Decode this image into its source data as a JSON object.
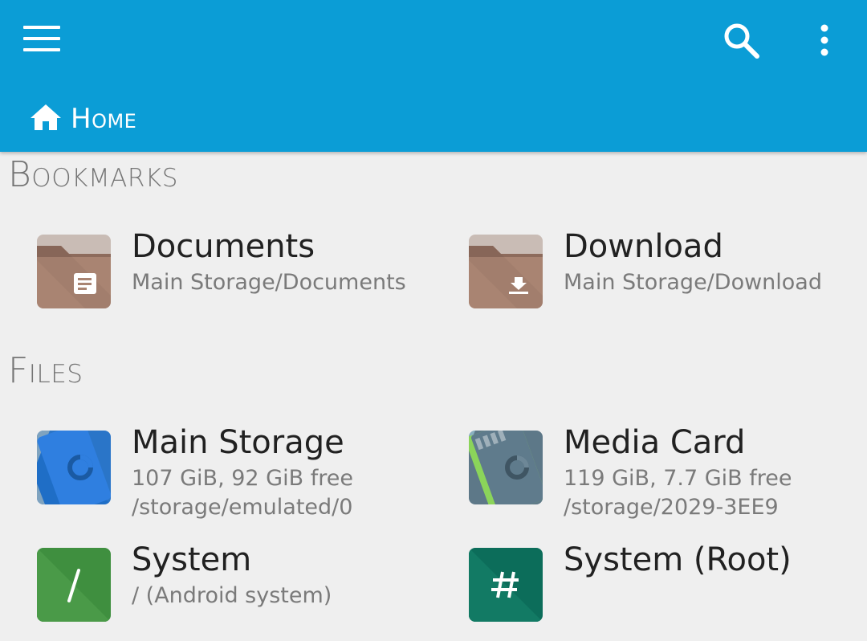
{
  "header": {
    "menu_icon": "hamburger-menu-icon",
    "search_icon": "search-icon",
    "more_icon": "more-vertical-icon",
    "breadcrumb": {
      "icon": "home-icon",
      "label": "Home"
    },
    "colors": {
      "appbar": "#0b9dd6",
      "background": "#efefef"
    }
  },
  "bookmarks": {
    "title": "Bookmarks",
    "items": [
      {
        "name": "Documents",
        "path": "Main Storage/Documents",
        "icon": "documents-folder-icon"
      },
      {
        "name": "Download",
        "path": "Main Storage/Download",
        "icon": "download-folder-icon"
      }
    ]
  },
  "files": {
    "title": "Files",
    "items": [
      {
        "name": "Main Storage",
        "size": "107 GiB, 92 GiB free",
        "path": "/storage/emulated/0",
        "icon": "phone-storage-icon"
      },
      {
        "name": "Media Card",
        "size": "119 GiB, 7.7 GiB free",
        "path": "/storage/2029-3EE9",
        "icon": "sd-card-icon"
      },
      {
        "name": "System",
        "path": "/ (Android system)",
        "icon": "root-slash-icon"
      },
      {
        "name": "System (Root)",
        "icon": "hash-root-icon"
      }
    ]
  }
}
